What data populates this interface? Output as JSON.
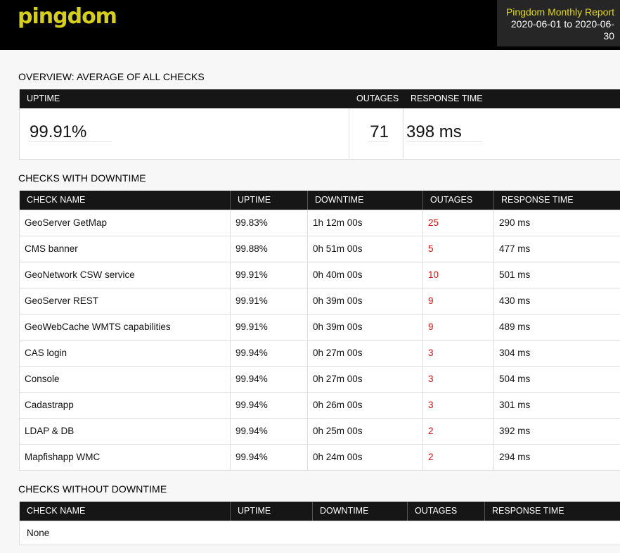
{
  "header": {
    "logo": "pingdom",
    "report_title": "Pingdom Monthly Report",
    "report_range_line1": "2020-06-01 to 2020-06-",
    "report_range_line2": "30"
  },
  "overview": {
    "title": "OVERVIEW: AVERAGE OF ALL CHECKS",
    "headers": {
      "uptime": "UPTIME",
      "outages": "OUTAGES",
      "response_time": "RESPONSE TIME"
    },
    "uptime": "99.91%",
    "outages": "71",
    "response_time": "398 ms"
  },
  "checks_with_downtime": {
    "title": "CHECKS WITH DOWNTIME",
    "headers": [
      "CHECK NAME",
      "UPTIME",
      "DOWNTIME",
      "OUTAGES",
      "RESPONSE TIME"
    ],
    "rows": [
      [
        "GeoServer GetMap",
        "99.83%",
        "1h 12m 00s",
        "25",
        "290 ms"
      ],
      [
        "CMS banner",
        "99.88%",
        "0h 51m 00s",
        "5",
        "477 ms"
      ],
      [
        "GeoNetwork CSW service",
        "99.91%",
        "0h 40m 00s",
        "10",
        "501 ms"
      ],
      [
        "GeoServer REST",
        "99.91%",
        "0h 39m 00s",
        "9",
        "430 ms"
      ],
      [
        "GeoWebCache WMTS capabilities",
        "99.91%",
        "0h 39m 00s",
        "9",
        "489 ms"
      ],
      [
        "CAS login",
        "99.94%",
        "0h 27m 00s",
        "3",
        "304 ms"
      ],
      [
        "Console",
        "99.94%",
        "0h 27m 00s",
        "3",
        "504 ms"
      ],
      [
        "Cadastrapp",
        "99.94%",
        "0h 26m 00s",
        "3",
        "301 ms"
      ],
      [
        "LDAP & DB",
        "99.94%",
        "0h 25m 00s",
        "2",
        "392 ms"
      ],
      [
        "Mapfishapp WMC",
        "99.94%",
        "0h 24m 00s",
        "2",
        "294 ms"
      ]
    ]
  },
  "checks_without_downtime": {
    "title": "CHECKS WITHOUT DOWNTIME",
    "headers": [
      "CHECK NAME",
      "UPTIME",
      "DOWNTIME",
      "OUTAGES",
      "RESPONSE TIME"
    ],
    "empty_text": "None"
  },
  "colors": {
    "brand": "#d7cf14",
    "outage": "#d21414",
    "header_bg": "#161616"
  }
}
